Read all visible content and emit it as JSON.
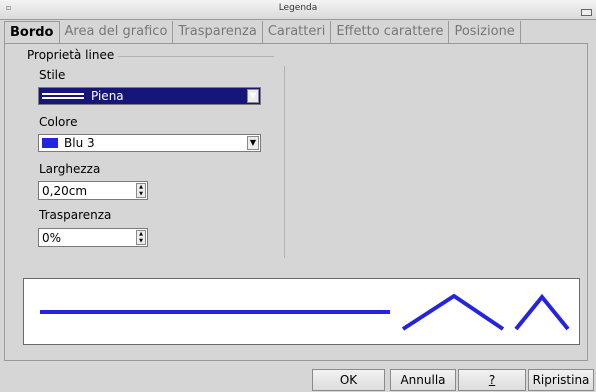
{
  "window": {
    "title": "Legenda"
  },
  "tabs": [
    {
      "label": "Bordo",
      "active": true
    },
    {
      "label": "Area del grafico",
      "active": false
    },
    {
      "label": "Trasparenza",
      "active": false
    },
    {
      "label": "Caratteri",
      "active": false
    },
    {
      "label": "Effetto carattere",
      "active": false
    },
    {
      "label": "Posizione",
      "active": false
    }
  ],
  "group": {
    "title": "Proprietà linee"
  },
  "style": {
    "label": "Stile",
    "value": "Piena"
  },
  "color": {
    "label": "Colore",
    "value": "Blu 3",
    "swatch": "#2323e0"
  },
  "width": {
    "label": "Larghezza",
    "value": "0,20cm"
  },
  "transparency": {
    "label": "Trasparenza",
    "value": "0%"
  },
  "preview": {
    "line_color": "#2323e0"
  },
  "buttons": {
    "ok": "OK",
    "cancel": "Annulla",
    "help": "?",
    "reset": "Ripristina"
  },
  "icons": {
    "menu": "window-menu-icon",
    "roll": "window-shade-icon"
  }
}
